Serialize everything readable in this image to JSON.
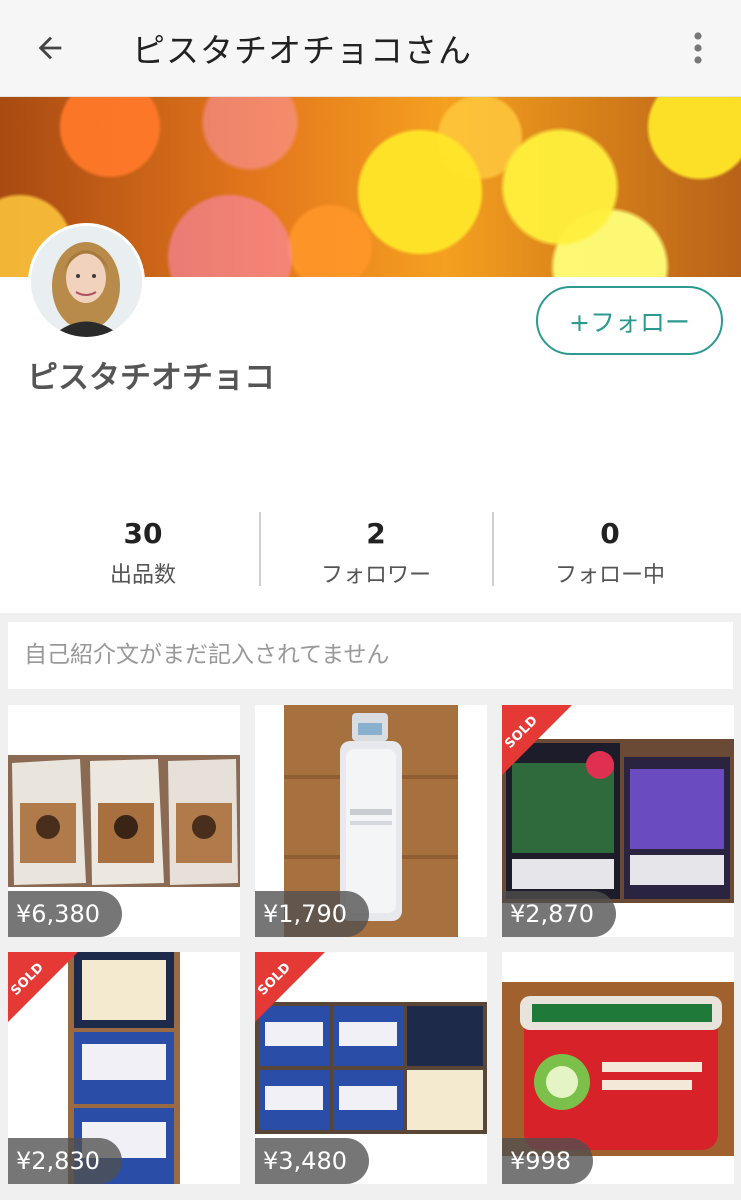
{
  "appbar": {
    "title": "ピスタチオチョコさん",
    "back_icon": "arrow-back-icon",
    "more_icon": "more-vert-icon"
  },
  "profile": {
    "name": "ピスタチオチョコ",
    "follow_label": "+フォロー",
    "avatar_icon": "avatar-photo"
  },
  "stats": [
    {
      "value": "30",
      "label": "出品数"
    },
    {
      "value": "2",
      "label": "フォロワー"
    },
    {
      "value": "0",
      "label": "フォロー中"
    }
  ],
  "intro_placeholder": "自己紹介文がまだ記入されてません",
  "sold_label": "SOLD",
  "items": [
    {
      "price": "¥6,380",
      "sold": false
    },
    {
      "price": "¥1,790",
      "sold": false
    },
    {
      "price": "¥2,870",
      "sold": true
    },
    {
      "price": "¥2,830",
      "sold": true
    },
    {
      "price": "¥3,480",
      "sold": true
    },
    {
      "price": "¥998",
      "sold": false
    }
  ],
  "colors": {
    "accent": "#2c9a8f",
    "sold_badge": "#e53935"
  }
}
